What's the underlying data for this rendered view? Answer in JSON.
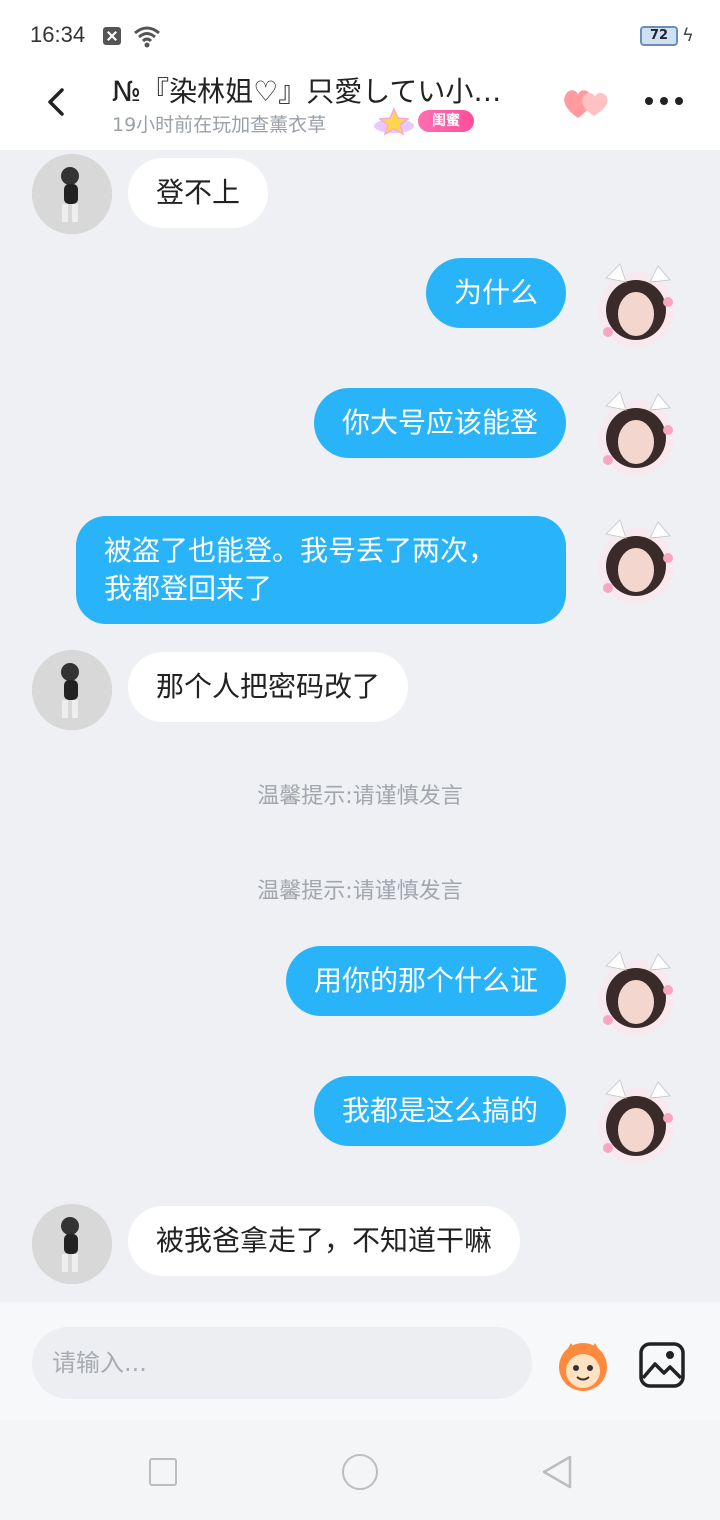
{
  "status_bar": {
    "time": "16:34",
    "battery": "72"
  },
  "header": {
    "title": "№『染林姐♡』只愛してい小…",
    "subtitle": "19小时前在玩加查薰衣草",
    "tag": "闺蜜"
  },
  "messages": [
    {
      "side": "left",
      "text": "登不上"
    },
    {
      "side": "right",
      "text": "为什么"
    },
    {
      "side": "right",
      "text": "你大号应该能登"
    },
    {
      "side": "right",
      "line1": "被盗了也能登。我号丢了两次，",
      "line2": "我都登回来了"
    },
    {
      "side": "left",
      "text": "那个人把密码改了"
    },
    {
      "side": "right",
      "text": "用你的那个什么证"
    },
    {
      "side": "right",
      "text": "我都是这么搞的"
    },
    {
      "side": "left",
      "text": "被我爸拿走了，不知道干嘛"
    }
  ],
  "notices": [
    "温馨提示:请谨慎发言",
    "温馨提示:请谨慎发言"
  ],
  "input": {
    "placeholder": "请输入..."
  },
  "colors": {
    "self_bubble": "#29b4fa",
    "other_bubble": "#ffffff",
    "background": "#eef0f4",
    "tag": "#ff4d9a"
  },
  "icons": [
    "back-arrow-icon",
    "hearts-icon",
    "more-icon",
    "emoji-icon",
    "image-icon",
    "nav-recent-icon",
    "nav-home-icon",
    "nav-back-icon"
  ]
}
